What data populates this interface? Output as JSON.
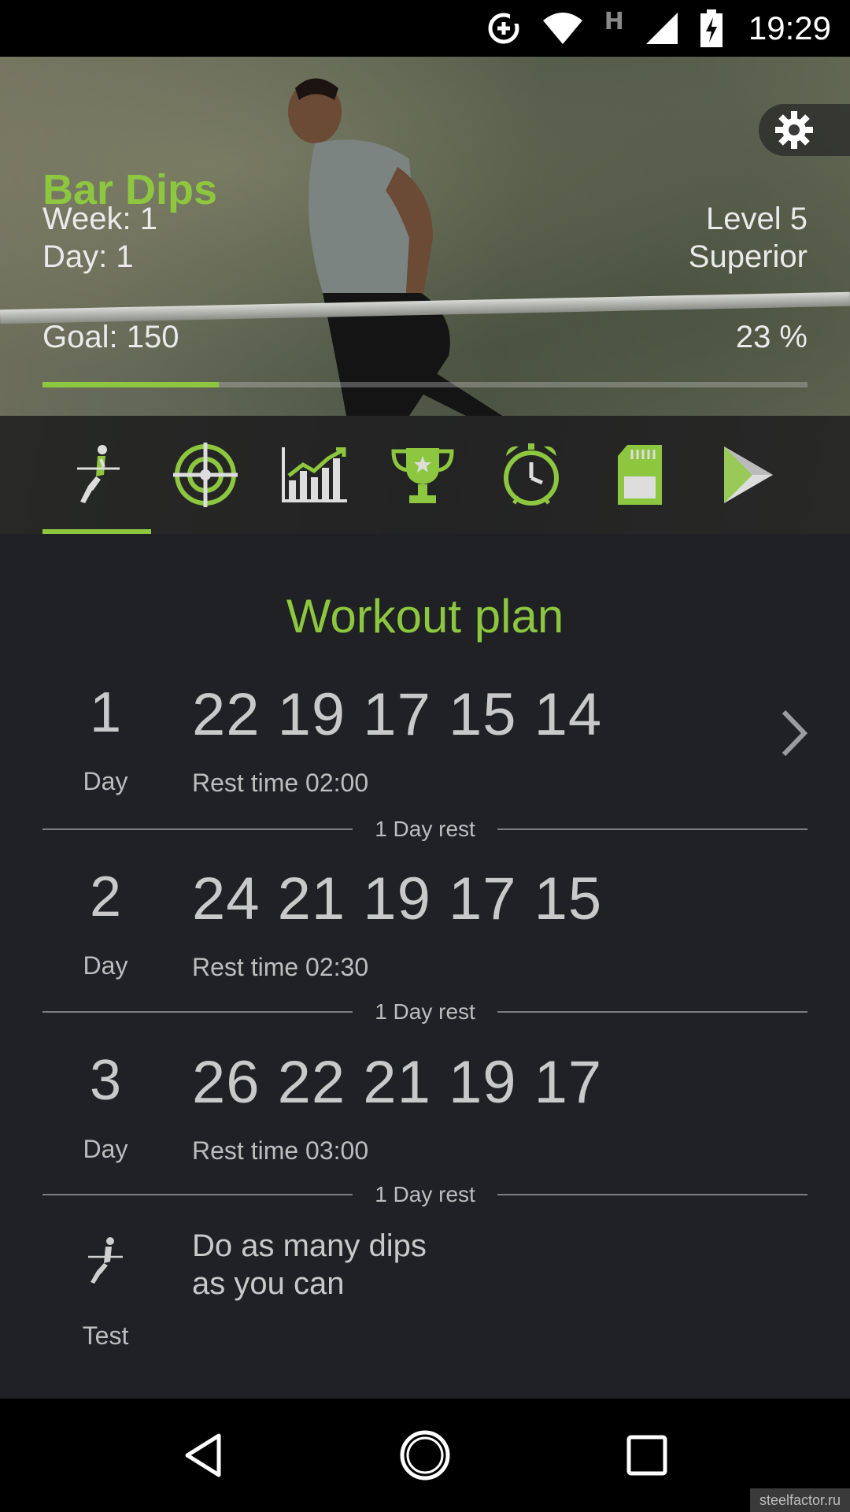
{
  "status_bar": {
    "time": "19:29",
    "network_type": "H",
    "icons": [
      "data-saver-icon",
      "wifi-icon",
      "signal-icon",
      "battery-charging-icon"
    ]
  },
  "header": {
    "title": "Bar Dips",
    "week": "Week: 1",
    "day": "Day: 1",
    "level": "Level 5",
    "level_name": "Superior",
    "goal": "Goal: 150",
    "progress_text": "23 %",
    "progress": 0.23,
    "settings_icon": "gear-icon"
  },
  "tabs": [
    {
      "name": "workout",
      "icon": "dips-figure-icon",
      "active": true
    },
    {
      "name": "target",
      "icon": "target-icon",
      "active": false
    },
    {
      "name": "statistics",
      "icon": "chart-icon",
      "active": false
    },
    {
      "name": "achievements",
      "icon": "trophy-icon",
      "active": false
    },
    {
      "name": "reminder",
      "icon": "alarm-clock-icon",
      "active": false
    },
    {
      "name": "backup",
      "icon": "sd-card-icon",
      "active": false
    },
    {
      "name": "more-apps",
      "icon": "play-store-icon",
      "active": false
    }
  ],
  "workout_plan": {
    "title": "Workout plan",
    "days": [
      {
        "number": "1",
        "label": "Day",
        "reps": "22 19 17 15 14",
        "rest": "Rest time 02:00"
      },
      {
        "number": "2",
        "label": "Day",
        "reps": "24 21 19 17 15",
        "rest": "Rest time 02:30"
      },
      {
        "number": "3",
        "label": "Day",
        "reps": "26 22 21 19 17",
        "rest": "Rest time 03:00"
      }
    ],
    "rest_label": "1 Day rest",
    "test": {
      "label": "Test",
      "line1": "Do as many dips",
      "line2": "as you can"
    }
  },
  "nav_bar": {
    "back": "back-icon",
    "home": "home-icon",
    "recents": "recents-icon"
  },
  "watermark": "steelfactor.ru",
  "colors": {
    "accent": "#8dc63f",
    "background": "#1f2124",
    "text": "#c9c9c9"
  }
}
